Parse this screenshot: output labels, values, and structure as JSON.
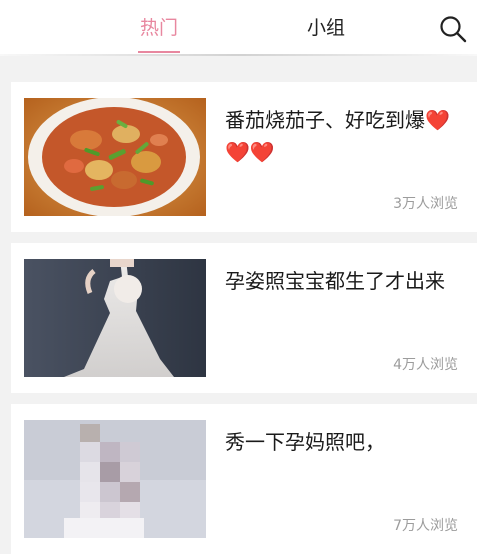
{
  "header": {
    "tabs": [
      {
        "label": "热门",
        "active": true
      },
      {
        "label": "小组",
        "active": false
      }
    ],
    "search_icon": "search-icon"
  },
  "colors": {
    "active_tab": "#e8879f",
    "heart": "#e0393e",
    "views_text": "#9c9c9c",
    "background": "#f2f2f2"
  },
  "posts": [
    {
      "title": "番茄烧茄子、好吃到爆",
      "title_emoji": "❤️❤️❤️",
      "views": "3万人浏览",
      "thumbnail": "stewed-eggplant-tomato-dish-photo"
    },
    {
      "title": "孕姿照宝宝都生了才出来",
      "views": "4万人浏览",
      "thumbnail": "maternity-white-dress-photo"
    },
    {
      "title": "秀一下孕妈照吧，",
      "views": "7万人浏览",
      "thumbnail": "pixelated-maternity-photo"
    }
  ]
}
